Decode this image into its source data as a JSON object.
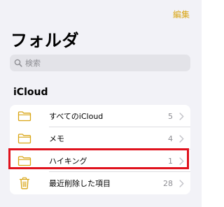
{
  "header": {
    "edit_label": "編集",
    "title": "フォルダ"
  },
  "search": {
    "placeholder": "検索"
  },
  "section": {
    "title": "iCloud"
  },
  "folders": [
    {
      "label": "すべてのiCloud",
      "count": "5",
      "icon": "folder-icon"
    },
    {
      "label": "メモ",
      "count": "4",
      "icon": "folder-icon"
    },
    {
      "label": "ハイキング",
      "count": "1",
      "icon": "folder-icon",
      "highlighted": true
    },
    {
      "label": "最近削除した項目",
      "count": "28",
      "icon": "trash-icon"
    }
  ],
  "colors": {
    "accent": "#d9a514",
    "highlight_border": "#e0121d",
    "background": "#f2f2f7"
  }
}
